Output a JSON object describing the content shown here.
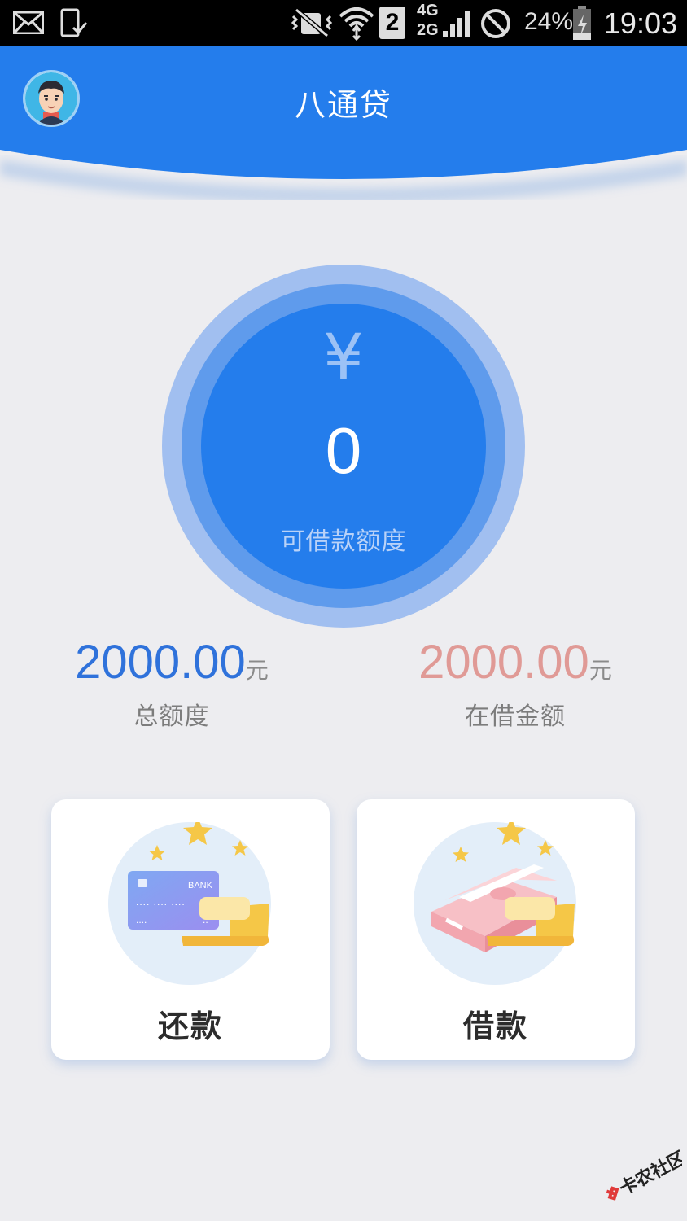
{
  "status_bar": {
    "sim_slot": "2",
    "network_top": "4G",
    "network_bottom": "2G",
    "battery": "24%",
    "time": "19:03",
    "icons": [
      "mail-icon",
      "phone-download-icon",
      "vibrate-mute-icon",
      "wifi-icon",
      "sim-icon",
      "signal-icon",
      "blocked-icon",
      "battery-icon"
    ]
  },
  "header": {
    "title": "八通贷",
    "avatar_icon": "user-avatar-icon",
    "color": "#247dec"
  },
  "credit": {
    "currency_symbol": "¥",
    "available": "0",
    "available_label": "可借款额度"
  },
  "stats": {
    "total": {
      "value": "2000.00",
      "unit": "元",
      "label": "总额度"
    },
    "borrowed": {
      "value": "2000.00",
      "unit": "元",
      "label": "在借金额"
    }
  },
  "actions": {
    "repay": {
      "label": "还款",
      "icon": "bank-card-icon"
    },
    "borrow": {
      "label": "借款",
      "icon": "cash-stack-icon"
    },
    "card_text": "BANK"
  },
  "watermark": {
    "text": "卡农社区"
  }
}
